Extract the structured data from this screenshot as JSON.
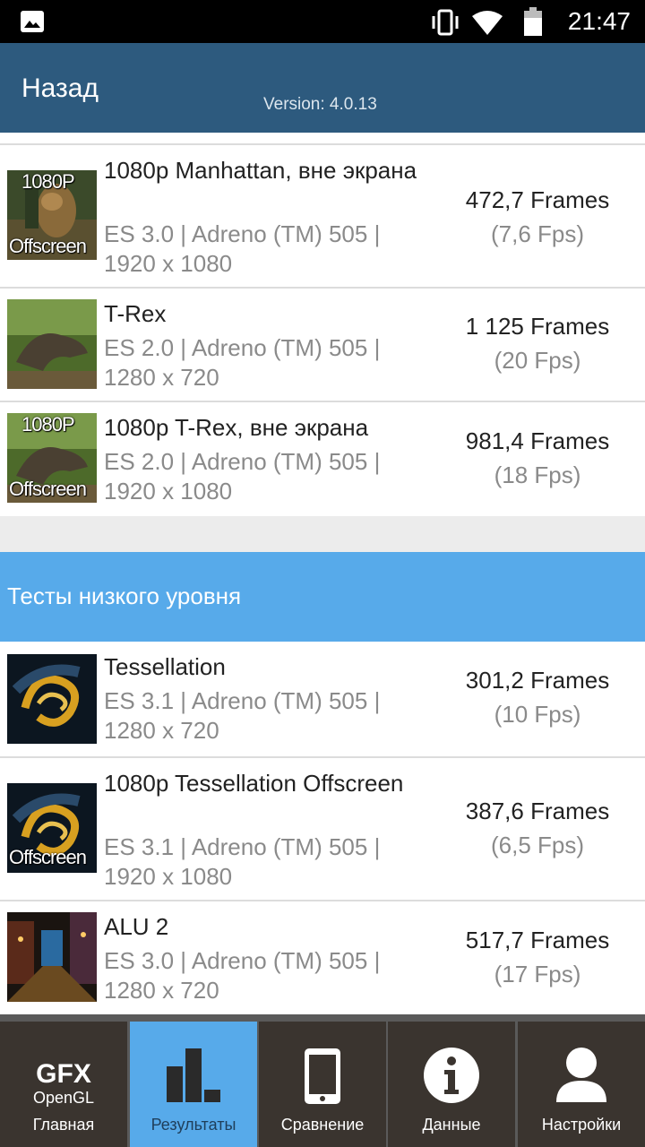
{
  "status": {
    "time": "21:47"
  },
  "appbar": {
    "back_label": "Назад",
    "version": "Version: 4.0.13"
  },
  "results_top": [
    {
      "thumb_tag": "1080P",
      "thumb_caption": "Offscreen",
      "title": "1080p Manhattan, вне экрана",
      "sub": "ES 3.0 | Adreno (TM) 505 | 1920 x 1080",
      "score": "472,7 Frames",
      "fps": "(7,6 Fps)"
    },
    {
      "thumb_tag": "",
      "thumb_caption": "",
      "title": "T-Rex",
      "sub": "ES 2.0 | Adreno (TM) 505 | 1280 x 720",
      "score": "1 125 Frames",
      "fps": "(20 Fps)"
    },
    {
      "thumb_tag": "1080P",
      "thumb_caption": "Offscreen",
      "title": "1080p T-Rex, вне экрана",
      "sub": "ES 2.0 | Adreno (TM) 505 | 1920 x 1080",
      "score": "981,4 Frames",
      "fps": "(18 Fps)"
    }
  ],
  "section_title": "Тесты низкого уровня",
  "results_low": [
    {
      "thumb_caption": "",
      "title": "Tessellation",
      "sub": "ES 3.1 | Adreno (TM) 505 | 1280 x 720",
      "score": "301,2 Frames",
      "fps": "(10 Fps)"
    },
    {
      "thumb_caption": "Offscreen",
      "title": "1080p Tessellation Offscreen",
      "sub": "ES 3.1 | Adreno (TM) 505 | 1920 x 1080",
      "score": "387,6 Frames",
      "fps": "(6,5 Fps)"
    },
    {
      "thumb_caption": "",
      "title": "ALU 2",
      "sub": "ES 3.0 | Adreno (TM) 505 | 1280 x 720",
      "score": "517,7 Frames",
      "fps": "(17 Fps)"
    }
  ],
  "nav": {
    "logo_main": "GFX",
    "logo_sub": "OpenGL",
    "items": [
      {
        "label": "Главная",
        "icon": "gfx-logo-icon"
      },
      {
        "label": "Результаты",
        "icon": "bar-chart-icon"
      },
      {
        "label": "Сравнение",
        "icon": "phone-icon"
      },
      {
        "label": "Данные",
        "icon": "info-icon"
      },
      {
        "label": "Настройки",
        "icon": "user-icon"
      }
    ],
    "active_index": 1
  },
  "colors": {
    "appbar": "#2d5a7e",
    "accent": "#57aaea",
    "nav_bg": "#3a342f"
  }
}
